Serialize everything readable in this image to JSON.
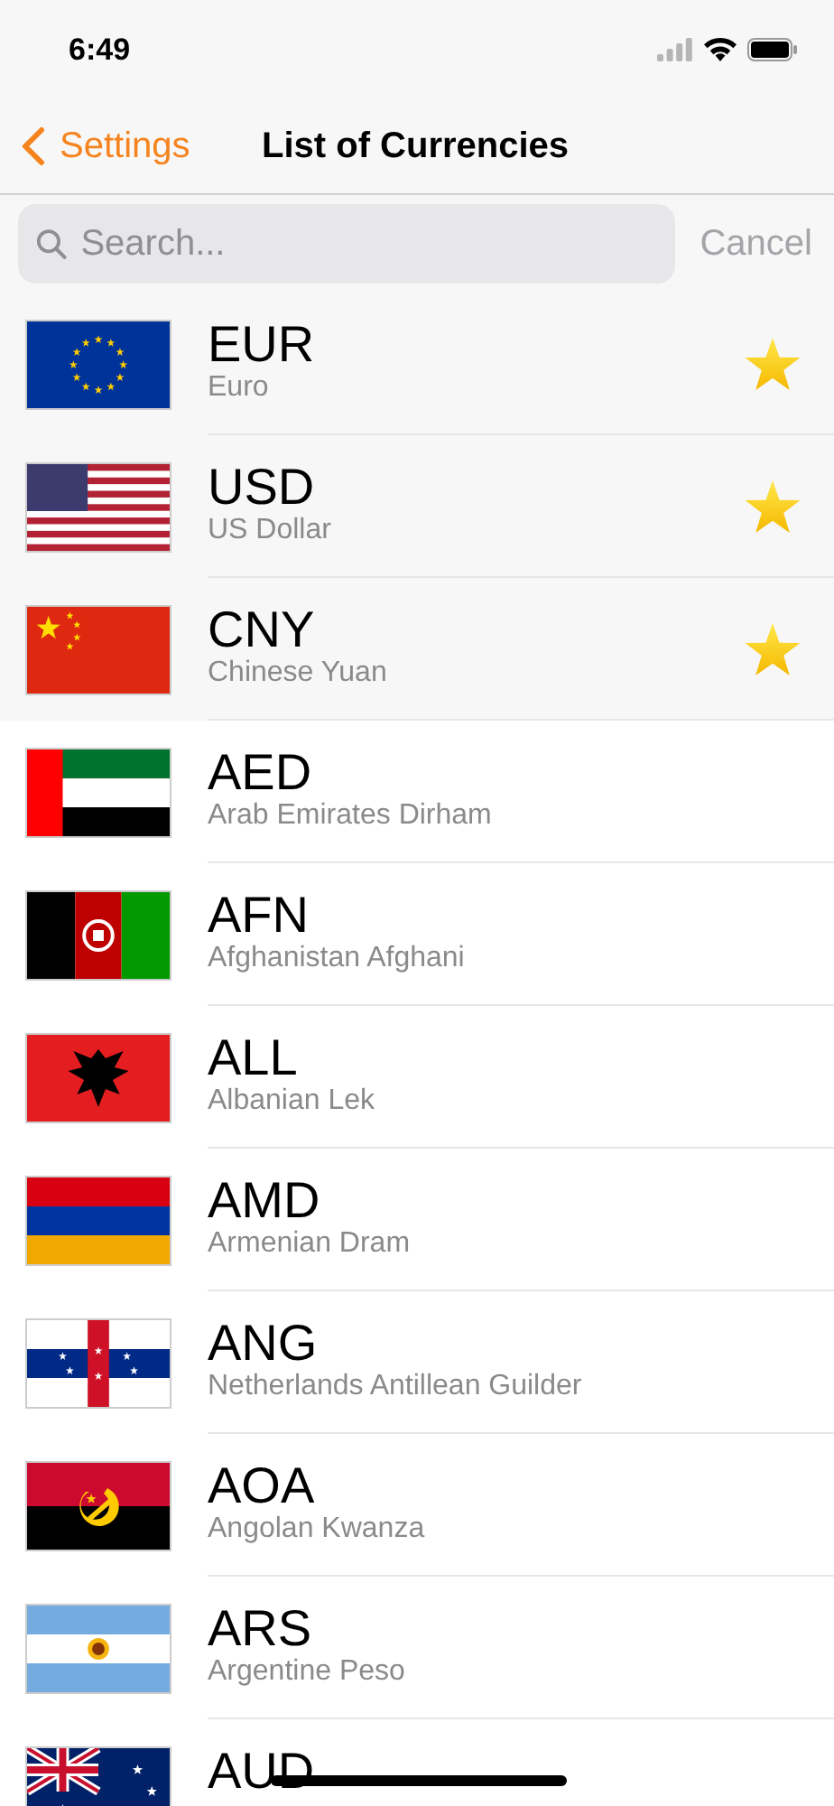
{
  "status_bar": {
    "time": "6:49"
  },
  "nav": {
    "back": "Settings",
    "title": "List of Currencies"
  },
  "search": {
    "placeholder": "Search...",
    "cancel": "Cancel"
  },
  "currencies": [
    {
      "code": "EUR",
      "name": "Euro",
      "favorite": true
    },
    {
      "code": "USD",
      "name": "US Dollar",
      "favorite": true
    },
    {
      "code": "CNY",
      "name": "Chinese Yuan",
      "favorite": true
    },
    {
      "code": "AED",
      "name": "Arab Emirates Dirham",
      "favorite": false
    },
    {
      "code": "AFN",
      "name": "Afghanistan Afghani",
      "favorite": false
    },
    {
      "code": "ALL",
      "name": "Albanian Lek",
      "favorite": false
    },
    {
      "code": "AMD",
      "name": "Armenian Dram",
      "favorite": false
    },
    {
      "code": "ANG",
      "name": "Netherlands Antillean Guilder",
      "favorite": false
    },
    {
      "code": "AOA",
      "name": "Angolan Kwanza",
      "favorite": false
    },
    {
      "code": "ARS",
      "name": "Argentine Peso",
      "favorite": false
    },
    {
      "code": "AUD",
      "favorite": false
    }
  ]
}
